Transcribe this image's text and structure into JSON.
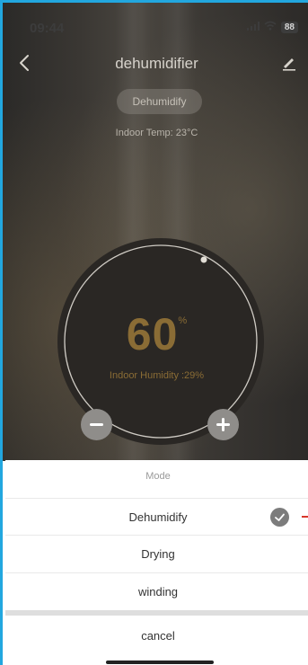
{
  "status_bar": {
    "time": "09:44",
    "battery": "88"
  },
  "header": {
    "title": "dehumidifier"
  },
  "mode_pill": "Dehumidify",
  "indoor_temp": "Indoor Temp: 23°C",
  "humidity": {
    "value": "60",
    "unit": "%",
    "indoor": "Indoor Humidity :29%"
  },
  "sheet": {
    "title": "Mode",
    "options": [
      {
        "label": "Dehumidify",
        "selected": true
      },
      {
        "label": "Drying",
        "selected": false
      },
      {
        "label": "winding",
        "selected": false
      }
    ],
    "cancel": "cancel"
  },
  "colors": {
    "accent": "#8a6c35",
    "frame": "#22a7df",
    "check": "#7c7c7c"
  },
  "icons": [
    "back-arrow-icon",
    "edit-pencil-icon",
    "signal-icon",
    "wifi-icon",
    "battery-icon",
    "minus-icon",
    "plus-icon",
    "check-icon"
  ]
}
